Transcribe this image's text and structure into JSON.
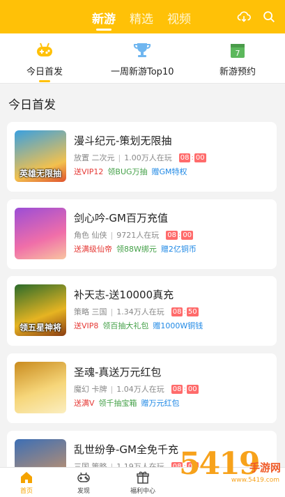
{
  "header": {
    "tabs": [
      {
        "label": "新游",
        "active": true
      },
      {
        "label": "精选",
        "active": false
      },
      {
        "label": "视频",
        "active": false
      }
    ],
    "icons": [
      "cloud-download-icon",
      "search-icon"
    ],
    "color": "#ffc107"
  },
  "quick_nav": [
    {
      "label": "今日首发",
      "icon": "gamepad-icon",
      "active": true
    },
    {
      "label": "一周新游Top10",
      "icon": "trophy-icon",
      "active": false
    },
    {
      "label": "新游预约",
      "icon": "calendar-icon",
      "active": false,
      "badge": "7"
    }
  ],
  "section_title": "今日首发",
  "games": [
    {
      "title": "漫斗纪元-策划无限抽",
      "genre": "放置 二次元",
      "players": "1.00万人在玩",
      "time_h": "08",
      "time_m": "00",
      "tags": [
        "送VIP12",
        "领BUG万抽",
        "赠GM特权"
      ],
      "thumb_text": "英雄无限抽",
      "thumb_colors": [
        "#3aa0e0",
        "#f2c14e"
      ]
    },
    {
      "title": "剑心吟-GM百万充值",
      "genre": "角色 仙侠",
      "players": "9721人在玩",
      "time_h": "08",
      "time_m": "00",
      "tags": [
        "送满级仙帝",
        "领88W绑元",
        "赠2亿铜币"
      ],
      "thumb_text": "",
      "thumb_colors": [
        "#9b4dd6",
        "#f06ea9"
      ]
    },
    {
      "title": "补天志-送10000真充",
      "genre": "策略 三国",
      "players": "1.34万人在玩",
      "time_h": "08",
      "time_m": "50",
      "tags": [
        "送VIP8",
        "领百抽大礼包",
        "赠1000W铜钱"
      ],
      "thumb_text": "领五星神将",
      "thumb_colors": [
        "#2b6b2b",
        "#e6b422"
      ]
    },
    {
      "title": "圣魂-真送万元红包",
      "genre": "魔幻 卡牌",
      "players": "1.04万人在玩",
      "time_h": "08",
      "time_m": "00",
      "tags": [
        "送满V",
        "领千抽宝箱",
        "赠万元红包"
      ],
      "thumb_text": "",
      "thumb_colors": [
        "#c98b1e",
        "#f6d67a"
      ]
    },
    {
      "title": "乱世纷争-GM全免千充",
      "genre": "三国 策略",
      "players": "1.19万人在玩",
      "time_h": "08",
      "time_m": "00",
      "tags": [],
      "thumb_text": "",
      "thumb_colors": [
        "#3d6fb5",
        "#e39a5a"
      ]
    }
  ],
  "bottom_nav": [
    {
      "label": "首页",
      "icon": "home-icon",
      "active": true
    },
    {
      "label": "发现",
      "icon": "controller-icon",
      "active": false
    },
    {
      "label": "福利中心",
      "icon": "gift-icon",
      "active": false
    }
  ],
  "watermark": {
    "big": "54",
    "mid": "19",
    "small": "手游网",
    "url": "www.5419.com"
  }
}
